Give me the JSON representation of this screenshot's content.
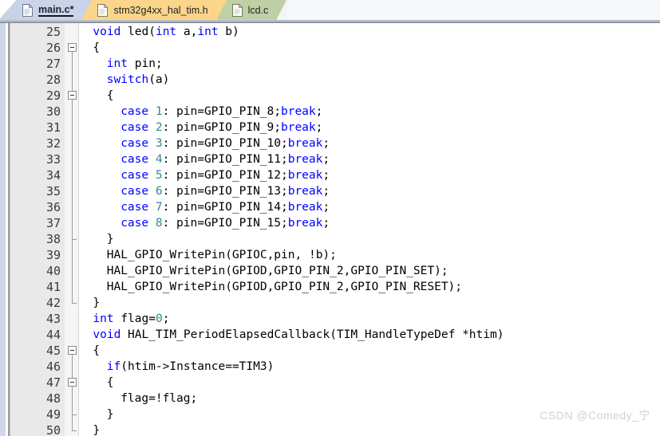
{
  "tabs": [
    {
      "label": "main.c*",
      "state": "active",
      "color": "#c9d4e8",
      "icon": "document-icon"
    },
    {
      "label": "stm32g4xx_hal_tim.h",
      "state": "inactive",
      "color": "#fbd589",
      "icon": "document-icon"
    },
    {
      "label": "lcd.c",
      "state": "inactive",
      "color": "#bfd0a4",
      "icon": "document-icon"
    }
  ],
  "editor": {
    "first_line": 25,
    "last_line": 50,
    "language": "c",
    "colors": {
      "keyword": "#0000ff",
      "number": "#2e8b91",
      "text": "#000000",
      "gutter_bg": "#e9e9e9",
      "fold_bg": "#f5f5f5",
      "background": "#ffffff"
    },
    "lines": [
      {
        "n": "25",
        "indent": 1,
        "tokens": [
          {
            "t": "void",
            "c": "kw"
          },
          {
            "t": " led(",
            "c": ""
          },
          {
            "t": "int",
            "c": "kw"
          },
          {
            "t": " a,",
            "c": ""
          },
          {
            "t": "int",
            "c": "kw"
          },
          {
            "t": " b)",
            "c": ""
          }
        ]
      },
      {
        "n": "26",
        "indent": 1,
        "tokens": [
          {
            "t": "{",
            "c": ""
          }
        ]
      },
      {
        "n": "27",
        "indent": 2,
        "tokens": [
          {
            "t": "int",
            "c": "kw"
          },
          {
            "t": " pin;",
            "c": ""
          }
        ]
      },
      {
        "n": "28",
        "indent": 2,
        "tokens": [
          {
            "t": "switch",
            "c": "kw"
          },
          {
            "t": "(a)",
            "c": ""
          }
        ]
      },
      {
        "n": "29",
        "indent": 2,
        "tokens": [
          {
            "t": "{",
            "c": ""
          }
        ]
      },
      {
        "n": "30",
        "indent": 3,
        "tokens": [
          {
            "t": "case",
            "c": "kw"
          },
          {
            "t": " ",
            "c": ""
          },
          {
            "t": "1",
            "c": "num"
          },
          {
            "t": ": pin=GPIO_PIN_8;",
            "c": ""
          },
          {
            "t": "break",
            "c": "kw"
          },
          {
            "t": ";",
            "c": ""
          }
        ]
      },
      {
        "n": "31",
        "indent": 3,
        "tokens": [
          {
            "t": "case",
            "c": "kw"
          },
          {
            "t": " ",
            "c": ""
          },
          {
            "t": "2",
            "c": "num"
          },
          {
            "t": ": pin=GPIO_PIN_9;",
            "c": ""
          },
          {
            "t": "break",
            "c": "kw"
          },
          {
            "t": ";",
            "c": ""
          }
        ]
      },
      {
        "n": "32",
        "indent": 3,
        "tokens": [
          {
            "t": "case",
            "c": "kw"
          },
          {
            "t": " ",
            "c": ""
          },
          {
            "t": "3",
            "c": "num"
          },
          {
            "t": ": pin=GPIO_PIN_10;",
            "c": ""
          },
          {
            "t": "break",
            "c": "kw"
          },
          {
            "t": ";",
            "c": ""
          }
        ]
      },
      {
        "n": "33",
        "indent": 3,
        "tokens": [
          {
            "t": "case",
            "c": "kw"
          },
          {
            "t": " ",
            "c": ""
          },
          {
            "t": "4",
            "c": "num"
          },
          {
            "t": ": pin=GPIO_PIN_11;",
            "c": ""
          },
          {
            "t": "break",
            "c": "kw"
          },
          {
            "t": ";",
            "c": ""
          }
        ]
      },
      {
        "n": "34",
        "indent": 3,
        "tokens": [
          {
            "t": "case",
            "c": "kw"
          },
          {
            "t": " ",
            "c": ""
          },
          {
            "t": "5",
            "c": "num"
          },
          {
            "t": ": pin=GPIO_PIN_12;",
            "c": ""
          },
          {
            "t": "break",
            "c": "kw"
          },
          {
            "t": ";",
            "c": ""
          }
        ]
      },
      {
        "n": "35",
        "indent": 3,
        "tokens": [
          {
            "t": "case",
            "c": "kw"
          },
          {
            "t": " ",
            "c": ""
          },
          {
            "t": "6",
            "c": "num"
          },
          {
            "t": ": pin=GPIO_PIN_13;",
            "c": ""
          },
          {
            "t": "break",
            "c": "kw"
          },
          {
            "t": ";",
            "c": ""
          }
        ]
      },
      {
        "n": "36",
        "indent": 3,
        "tokens": [
          {
            "t": "case",
            "c": "kw"
          },
          {
            "t": " ",
            "c": ""
          },
          {
            "t": "7",
            "c": "num"
          },
          {
            "t": ": pin=GPIO_PIN_14;",
            "c": ""
          },
          {
            "t": "break",
            "c": "kw"
          },
          {
            "t": ";",
            "c": ""
          }
        ]
      },
      {
        "n": "37",
        "indent": 3,
        "tokens": [
          {
            "t": "case",
            "c": "kw"
          },
          {
            "t": " ",
            "c": ""
          },
          {
            "t": "8",
            "c": "num"
          },
          {
            "t": ": pin=GPIO_PIN_15;",
            "c": ""
          },
          {
            "t": "break",
            "c": "kw"
          },
          {
            "t": ";",
            "c": ""
          }
        ]
      },
      {
        "n": "38",
        "indent": 2,
        "tokens": [
          {
            "t": "}",
            "c": ""
          }
        ]
      },
      {
        "n": "39",
        "indent": 2,
        "tokens": [
          {
            "t": "HAL_GPIO_WritePin(GPIOC,pin, !b);",
            "c": ""
          }
        ]
      },
      {
        "n": "40",
        "indent": 2,
        "tokens": [
          {
            "t": "HAL_GPIO_WritePin(GPIOD,GPIO_PIN_2,GPIO_PIN_SET);",
            "c": ""
          }
        ]
      },
      {
        "n": "41",
        "indent": 2,
        "tokens": [
          {
            "t": "HAL_GPIO_WritePin(GPIOD,GPIO_PIN_2,GPIO_PIN_RESET);",
            "c": ""
          }
        ]
      },
      {
        "n": "42",
        "indent": 1,
        "tokens": [
          {
            "t": "}",
            "c": ""
          }
        ]
      },
      {
        "n": "43",
        "indent": 1,
        "tokens": [
          {
            "t": "int",
            "c": "kw"
          },
          {
            "t": " flag=",
            "c": ""
          },
          {
            "t": "0",
            "c": "num"
          },
          {
            "t": ";",
            "c": ""
          }
        ]
      },
      {
        "n": "44",
        "indent": 1,
        "tokens": [
          {
            "t": "void",
            "c": "kw"
          },
          {
            "t": " HAL_TIM_PeriodElapsedCallback(TIM_HandleTypeDef *htim)",
            "c": ""
          }
        ]
      },
      {
        "n": "45",
        "indent": 1,
        "tokens": [
          {
            "t": "{",
            "c": ""
          }
        ]
      },
      {
        "n": "46",
        "indent": 2,
        "tokens": [
          {
            "t": "if",
            "c": "kw"
          },
          {
            "t": "(htim->Instance==TIM3)",
            "c": ""
          }
        ]
      },
      {
        "n": "47",
        "indent": 2,
        "tokens": [
          {
            "t": "{",
            "c": ""
          }
        ]
      },
      {
        "n": "48",
        "indent": 3,
        "tokens": [
          {
            "t": "flag=!flag;",
            "c": ""
          }
        ]
      },
      {
        "n": "49",
        "indent": 2,
        "tokens": [
          {
            "t": "}",
            "c": ""
          }
        ]
      },
      {
        "n": "50",
        "indent": 1,
        "tokens": [
          {
            "t": "}",
            "c": ""
          }
        ]
      }
    ],
    "fold_markers": [
      {
        "line": "26",
        "type": "collapse-box"
      },
      {
        "line": "29",
        "type": "collapse-box"
      },
      {
        "line": "45",
        "type": "collapse-box"
      },
      {
        "line": "47",
        "type": "collapse-box"
      }
    ],
    "fold_ranges": [
      {
        "from": "26",
        "to": "42",
        "depth": 0
      },
      {
        "from": "29",
        "to": "38",
        "depth": 1
      },
      {
        "from": "45",
        "to": "50",
        "depth": 0
      },
      {
        "from": "47",
        "to": "49",
        "depth": 1
      }
    ]
  },
  "watermark": {
    "text": "CSDN @Comedy_宁",
    "color": "#d2d2d2"
  }
}
